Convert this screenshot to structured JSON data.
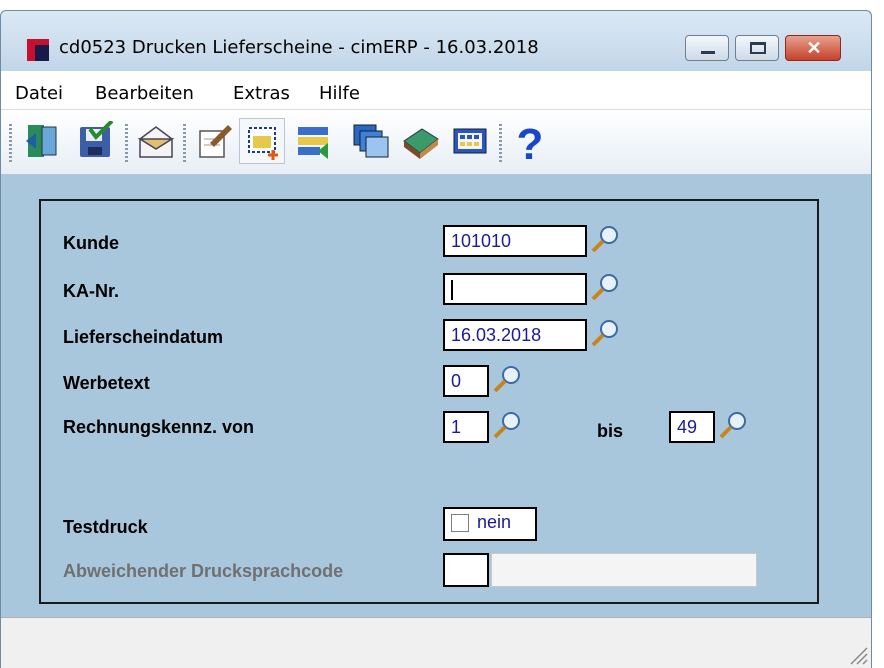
{
  "window": {
    "title": "cd0523 Drucken Lieferscheine - cimERP - 16.03.2018",
    "close_glyph": "✕"
  },
  "menu": [
    "Datei",
    "Bearbeiten",
    "Extras",
    "Hilfe"
  ],
  "toolbar": {
    "buttons": [
      "exit-icon",
      "save-icon",
      "mail-icon",
      "edit-icon",
      "new-record-icon",
      "transfer-icon",
      "windows-icon",
      "book-icon",
      "grid-icon",
      "help-icon"
    ],
    "help_glyph": "?"
  },
  "form": {
    "kunde": {
      "label": "Kunde",
      "value": "101010"
    },
    "ka_nr": {
      "label": "KA-Nr.",
      "value": ""
    },
    "lieferscheindatum": {
      "label": "Lieferscheindatum",
      "value": "16.03.2018"
    },
    "werbetext": {
      "label": "Werbetext",
      "value": "0"
    },
    "rechnungskennz": {
      "label": "Rechnungskennz. von",
      "value_from": "1",
      "bis_label": "bis",
      "value_to": "49"
    },
    "testdruck": {
      "label": "Testdruck",
      "checked": false,
      "text": "nein"
    },
    "druck_sprachcode": {
      "label": "Abweichender Drucksprachcode",
      "code": "",
      "description": "",
      "disabled": true
    }
  },
  "colors": {
    "content_bg": "#a9c7dc",
    "field_text": "#1a1a9a",
    "disabled_label": "#707070"
  }
}
